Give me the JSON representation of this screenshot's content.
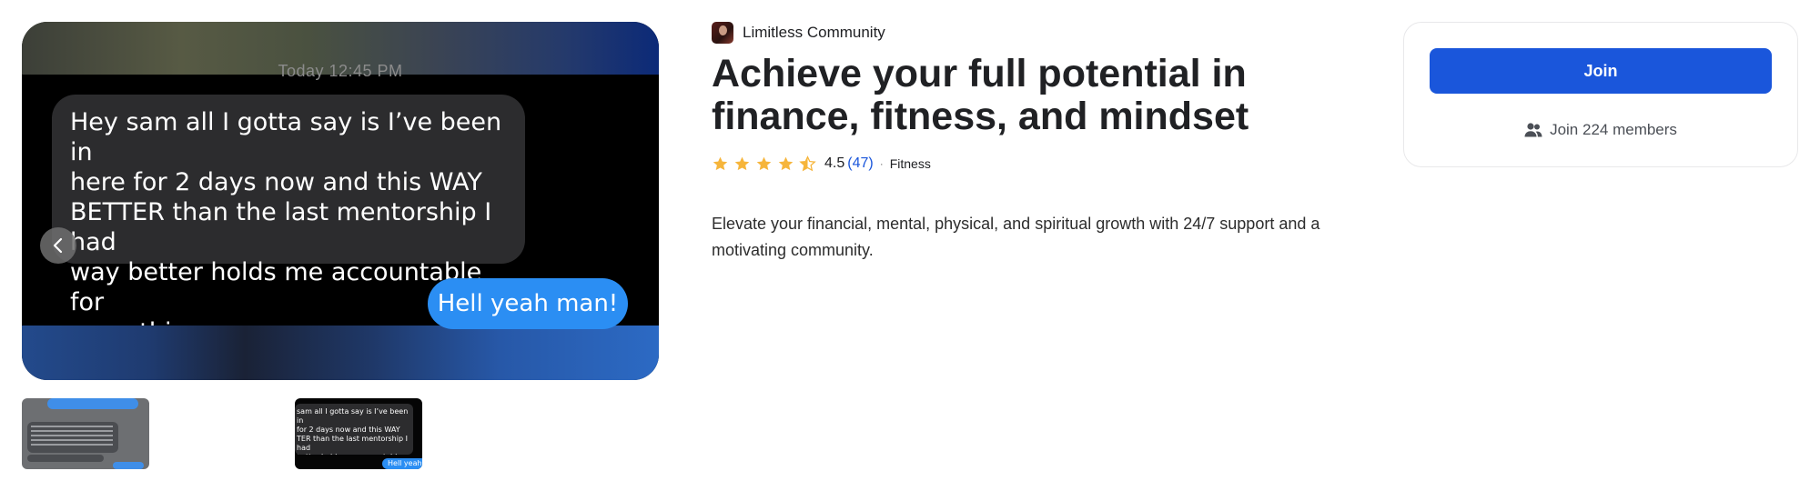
{
  "gallery": {
    "hero": {
      "timestamp": "Today 12:45 PM",
      "incoming_message": "Hey sam all I gotta say is I’ve been in\nhere for 2 days now and this WAY\nBETTER than the last mentorship I had\nway better holds me accountable for\neverything",
      "outgoing_message": "Hell yeah man!"
    },
    "prev_icon": "chevron-left-icon",
    "thumbnails": [
      {
        "label": ""
      },
      {
        "incoming_message": "sam all I gotta say is I’ve been in\n for 2 days now and this WAY\nTER than the last mentorship I had\nbetter holds me accountable for\nything",
        "outgoing_message": "Hell yeah m"
      }
    ]
  },
  "community": {
    "name": "Limitless Community",
    "title": "Achieve your full potential in finance, fitness, and mindset",
    "rating": "4.5",
    "rating_value": 4.5,
    "reviews": "(47)",
    "separator": "·",
    "category": "Fitness",
    "description": "Elevate your financial, mental, physical, and spiritual growth with 24/7 support and a motivating community."
  },
  "join_card": {
    "join_label": "Join",
    "members_label": "Join 224 members",
    "members_icon": "users-icon"
  },
  "colors": {
    "accent": "#1a56db",
    "star": "#f6b53b",
    "link": "#1a56db"
  }
}
